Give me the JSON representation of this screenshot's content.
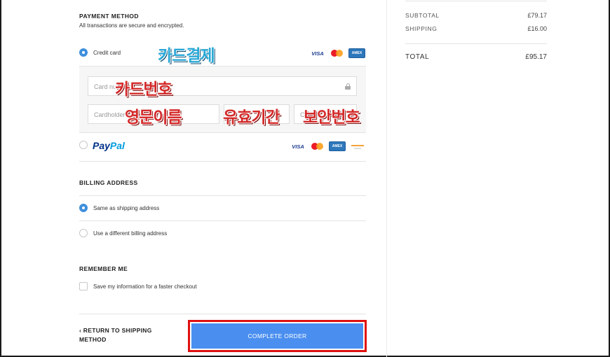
{
  "payment": {
    "title": "PAYMENT METHOD",
    "subtitle": "All transactions are secure and encrypted.",
    "credit_card_label": "Credit card",
    "card_number_placeholder": "Card number",
    "cardholder_placeholder": "Cardholder name",
    "expiry_placeholder": "",
    "cvc_placeholder": "CVC",
    "paypal_label_a": "Pay",
    "paypal_label_b": "Pal",
    "card_logos": [
      "visa-logo",
      "mastercard-logo",
      "amex-logo"
    ],
    "paypal_logos": [
      "visa-logo",
      "mastercard-logo",
      "amex-logo",
      "generic-card-logo"
    ]
  },
  "annotations": {
    "card_payment": "카드결제",
    "card_number": "카드번호",
    "english_name": "영문이름",
    "expiry": "유효기간",
    "security_code": "보안번호"
  },
  "billing": {
    "title": "BILLING ADDRESS",
    "same_label": "Same as shipping address",
    "different_label": "Use a different billing address"
  },
  "remember": {
    "title": "REMEMBER ME",
    "save_label": "Save my information for a faster checkout"
  },
  "footer": {
    "back_label": "‹ RETURN TO SHIPPING METHOD",
    "complete_label": "COMPLETE ORDER"
  },
  "summary": {
    "subtotal_label": "SUBTOTAL",
    "subtotal_value": "£79.17",
    "shipping_label": "SHIPPING",
    "shipping_value": "£16.00",
    "total_label": "TOTAL",
    "total_value": "£95.17"
  },
  "colors": {
    "accent": "#3f8fdc",
    "button": "#4a8ff0",
    "highlight_border": "#e01010",
    "annotation_red": "#d42a2a",
    "annotation_blue": "#2aa8d6"
  }
}
